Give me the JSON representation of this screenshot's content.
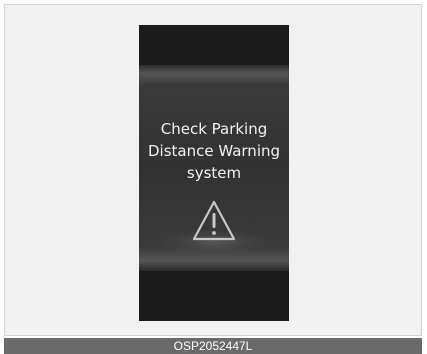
{
  "display": {
    "message_lines": [
      "Check Parking",
      "Distance Warning",
      "system"
    ],
    "icon": "warning-triangle-icon"
  },
  "caption": {
    "code": "OSP2052447L"
  },
  "colors": {
    "display_background": "#1b1b1b",
    "text": "#f2f2f2",
    "caption_bar": "#6a6a6a"
  }
}
